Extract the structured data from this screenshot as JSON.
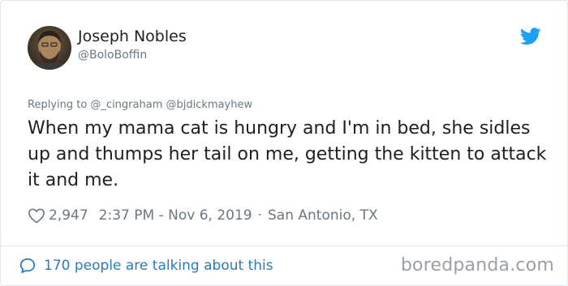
{
  "author": {
    "display_name": "Joseph Nobles",
    "handle": "@BoloBoffin"
  },
  "tweet": {
    "replying_to": "Replying to @_cingraham @bjdickmayhew",
    "text": "When my mama cat is hungry and I'm in bed, she sidles up and thumps her tail on me, getting the kitten to attack it and me.",
    "likes": "2,947",
    "timestamp": "2:37 PM - Nov 6, 2019",
    "separator": "·",
    "location": "San Antonio, TX"
  },
  "footer": {
    "talking": "170 people are talking about this",
    "watermark": "boredpanda.com"
  },
  "colors": {
    "twitter_blue": "#1da1f2",
    "link_blue": "#2b7bb9",
    "secondary_text": "#697882",
    "primary_text": "#1c2022",
    "divider": "#e1e8ed"
  },
  "icons": [
    "avatar",
    "twitter-bird-icon",
    "heart-icon",
    "speech-bubble-icon"
  ]
}
